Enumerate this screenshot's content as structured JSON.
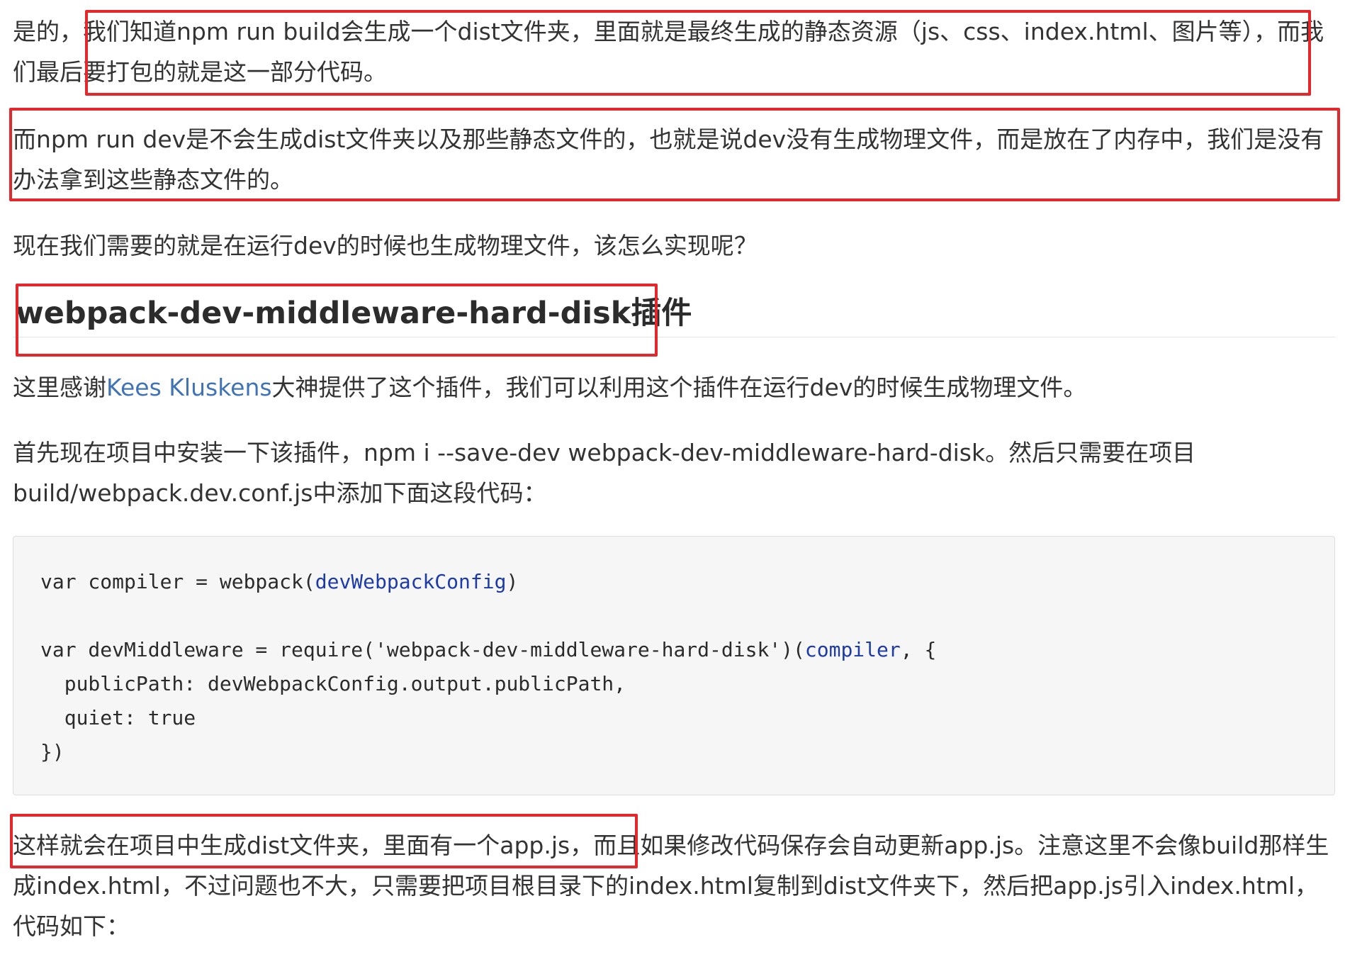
{
  "paragraphs": {
    "p1": "是的，我们知道npm run build会生成一个dist文件夹，里面就是最终生成的静态资源（js、css、index.html、图片等），而我们最后要打包的就是这一部分代码。",
    "p2": "而npm run dev是不会生成dist文件夹以及那些静态文件的，也就是说dev没有生成物理文件，而是放在了内存中，我们是没有办法拿到这些静态文件的。",
    "p3": "现在我们需要的就是在运行dev的时候也生成物理文件，该怎么实现呢？",
    "p4_before": "这里感谢",
    "p4_link": "Kees Kluskens",
    "p4_after": "大神提供了这个插件，我们可以利用这个插件在运行dev的时候生成物理文件。",
    "p5": "首先现在项目中安装一下该插件，npm i --save-dev webpack-dev-middleware-hard-disk。然后只需要在项目build/webpack.dev.conf.js中添加下面这段代码：",
    "p6": "这样就会在项目中生成dist文件夹，里面有一个app.js，而且如果修改代码保存会自动更新app.js。注意这里不会像build那样生成index.html，不过问题也不大，只需要把项目根目录下的index.html复制到dist文件夹下，然后把app.js引入index.html，代码如下："
  },
  "heading": "webpack-dev-middleware-hard-disk插件",
  "code": {
    "l1_a": "var compiler = webpack(",
    "l1_b": "devWebpackConfig",
    "l1_c": ")",
    "l3_a": "var devMiddleware = require('webpack-dev-middleware-hard-disk')(",
    "l3_b": "compiler",
    "l3_c": ", {",
    "l4": "  publicPath: devWebpackConfig.output.publicPath,",
    "l5": "  quiet: true",
    "l6": "})"
  },
  "colors": {
    "highlight_box": "#e5262a",
    "link": "#3f73b5",
    "code_background": "#f6f6f6",
    "code_identifier": "#1c3aa9"
  }
}
